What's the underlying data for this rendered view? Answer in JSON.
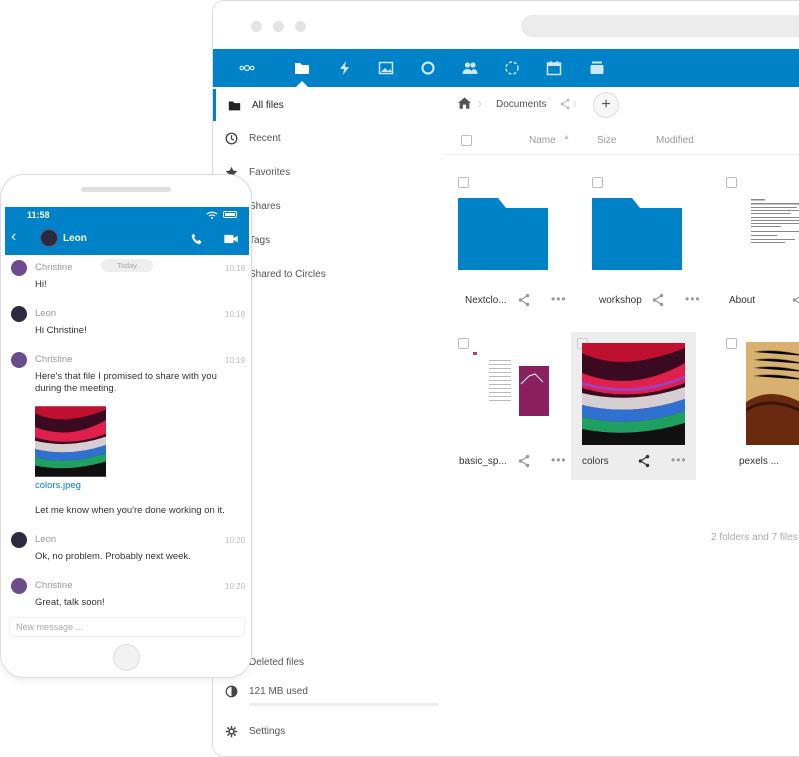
{
  "colors": {
    "brand": "#0082c9",
    "selected_tile": "#ededed"
  },
  "topbar": {
    "apps": [
      {
        "name": "logo",
        "icon": "nextcloud-logo"
      },
      {
        "name": "files",
        "icon": "folder-icon"
      },
      {
        "name": "activity",
        "icon": "activity-icon"
      },
      {
        "name": "photos",
        "icon": "image-icon"
      },
      {
        "name": "talk",
        "icon": "talk-icon"
      },
      {
        "name": "contacts",
        "icon": "contacts-icon"
      },
      {
        "name": "circles",
        "icon": "circles-icon"
      },
      {
        "name": "calendar",
        "icon": "calendar-icon"
      },
      {
        "name": "deck",
        "icon": "deck-icon"
      }
    ]
  },
  "sidebar": {
    "items": [
      {
        "label": "All files",
        "icon": "folder-icon"
      },
      {
        "label": "Recent",
        "icon": "clock-icon"
      },
      {
        "label": "Favorites",
        "icon": "star-icon"
      },
      {
        "label": "Shares",
        "icon": "share-icon"
      },
      {
        "label": "Tags",
        "icon": "tag-icon"
      },
      {
        "label": "Shared to Circles",
        "icon": "circles-icon"
      }
    ],
    "deleted": "Deleted files",
    "quota": "121 MB used",
    "settings": "Settings"
  },
  "main": {
    "breadcrumb": {
      "current": "Documents"
    },
    "columns": {
      "name": "Name",
      "size": "Size",
      "modified": "Modified"
    },
    "files": [
      {
        "name": "Nextclo...",
        "kind": "folder"
      },
      {
        "name": "workshop",
        "kind": "folder"
      },
      {
        "name": "About",
        "kind": "document"
      },
      {
        "name": "basic_sp...",
        "kind": "spreadsheet"
      },
      {
        "name": "colors",
        "kind": "image"
      },
      {
        "name": "pexels ...",
        "kind": "image"
      }
    ],
    "summary": "2 folders and 7 files"
  },
  "phone": {
    "time": "11:58",
    "contact": "Leon",
    "day": "Today",
    "messages": [
      {
        "author": "Christine",
        "time": "10:18",
        "text": "Hi!"
      },
      {
        "author": "Leon",
        "time": "10:18",
        "text": "Hi Christine!"
      },
      {
        "author": "Christine",
        "time": "10:19",
        "text": "Here's that file I promised to share with you during the meeting.",
        "attachment": "colors.jpeg",
        "followup": "Let me know when you're done working on it."
      },
      {
        "author": "Leon",
        "time": "10:20",
        "text": "Ok, no problem. Probably next week."
      },
      {
        "author": "Christine",
        "time": "10:20",
        "text": "Great, talk soon!"
      }
    ],
    "compose_placeholder": "New message ..."
  }
}
